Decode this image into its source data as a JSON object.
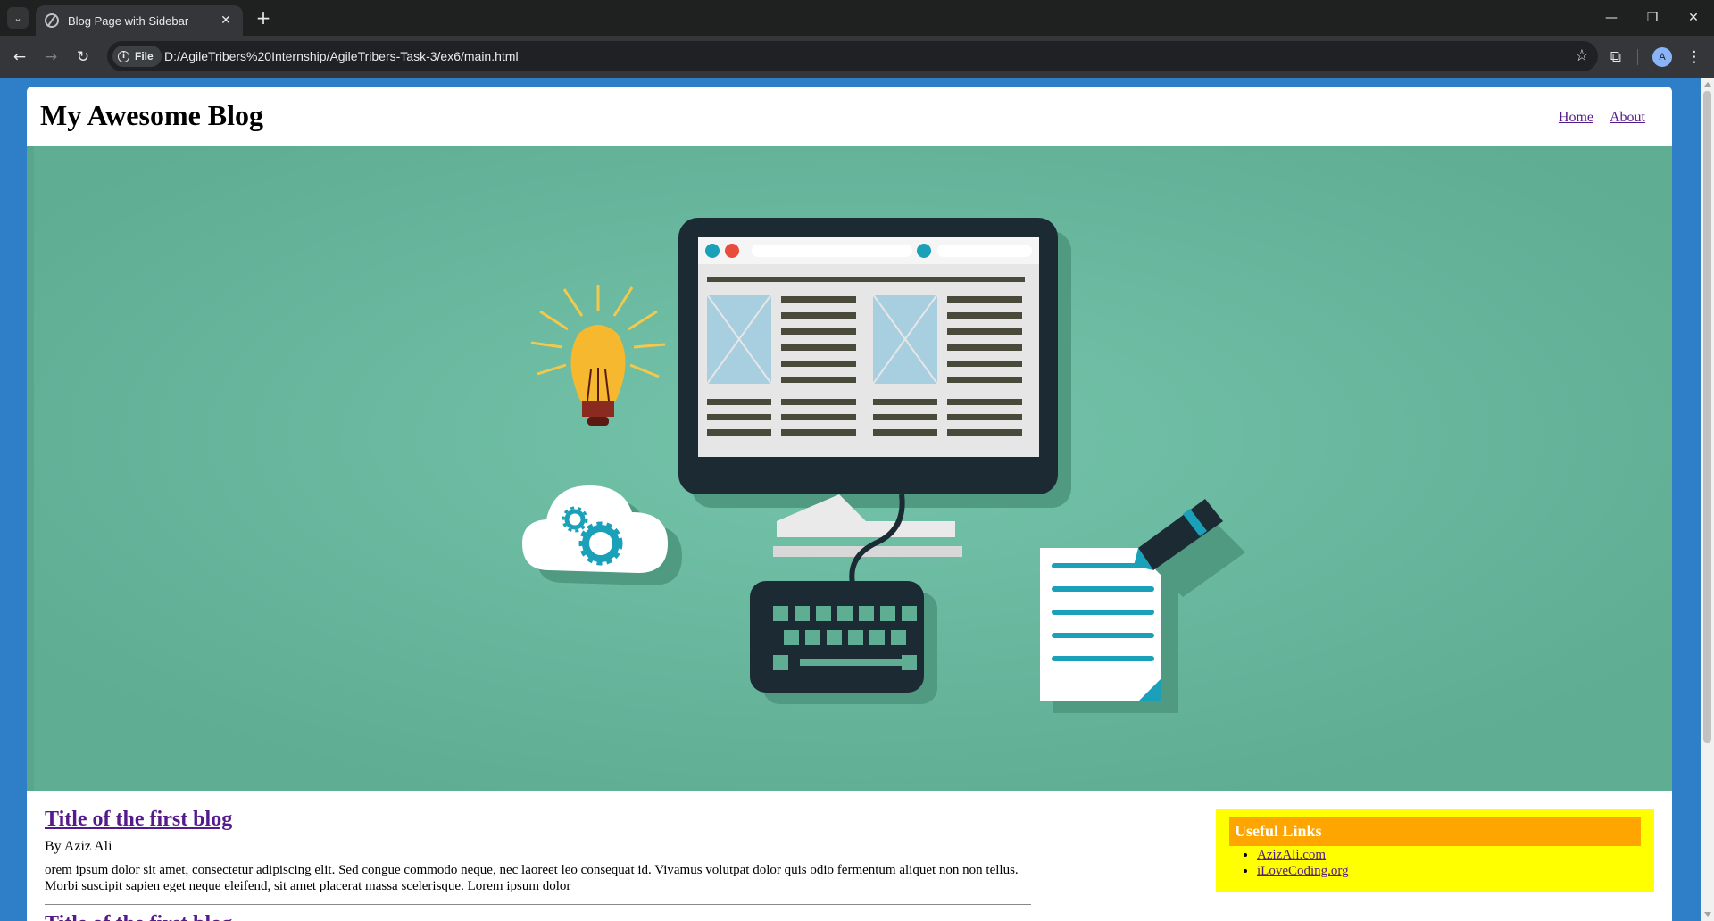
{
  "browser": {
    "tab_title": "Blog Page with Sidebar",
    "file_chip": "File",
    "url": "D:/AgileTribers%20Internship/AgileTribers-Task-3/ex6/main.html",
    "profile_initial": "A"
  },
  "site": {
    "title": "My Awesome Blog",
    "nav": [
      {
        "label": "Home"
      },
      {
        "label": "About"
      }
    ]
  },
  "posts": [
    {
      "title": "Title of the first blog",
      "author": "By Aziz Ali",
      "body": "orem ipsum dolor sit amet, consectetur adipiscing elit. Sed congue commodo neque, nec laoreet leo consequat id. Vivamus volutpat dolor quis odio fermentum aliquet non non tellus. Morbi suscipit sapien eget neque eleifend, sit amet placerat massa scelerisque. Lorem ipsum dolor"
    },
    {
      "title": "Title of the first blog"
    }
  ],
  "sidebar": {
    "heading": "Useful Links",
    "links": [
      {
        "label": "AzizAli.com"
      },
      {
        "label": "iLoveCoding.org"
      }
    ]
  },
  "colors": {
    "hero_bg": "#6bbda3",
    "sidebar_bg": "#ffff00",
    "sidebar_heading_bg": "#ffa500",
    "page_bg": "#2f7fc8",
    "link": "#551a8b"
  }
}
